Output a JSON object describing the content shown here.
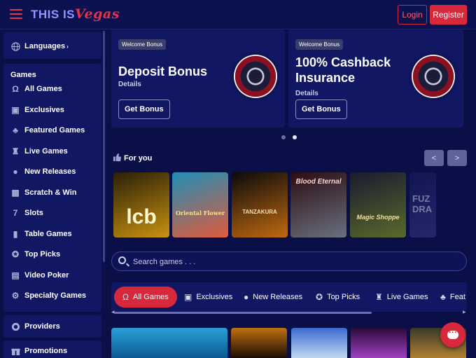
{
  "header": {
    "logo_part1": "THIS IS",
    "logo_part2": "Vegas",
    "login_label": "Login",
    "register_label": "Register"
  },
  "sidebar": {
    "languages_label": "Languages",
    "games_heading": "Games",
    "items": [
      {
        "label": "All Games",
        "icon": "horseshoe-icon"
      },
      {
        "label": "Exclusives",
        "icon": "exclusive-icon"
      },
      {
        "label": "Featured Games",
        "icon": "clover-icon"
      },
      {
        "label": "Live Games",
        "icon": "live-dealer-icon"
      },
      {
        "label": "New Releases",
        "icon": "cherries-icon"
      },
      {
        "label": "Scratch & Win",
        "icon": "scratch-card-icon"
      },
      {
        "label": "Slots",
        "icon": "seven-icon"
      },
      {
        "label": "Table Games",
        "icon": "table-games-icon"
      },
      {
        "label": "Top Picks",
        "icon": "medal-icon"
      },
      {
        "label": "Video Poker",
        "icon": "video-poker-icon"
      },
      {
        "label": "Specialty Games",
        "icon": "gear-icon"
      }
    ],
    "providers_label": "Providers",
    "promotions_label": "Promotions"
  },
  "banners": [
    {
      "tag": "Welcome Bonus",
      "title_line1": "Deposit Bonus",
      "title_line2": "",
      "details": "Details",
      "button": "Get Bonus"
    },
    {
      "tag": "Welcome Bonus",
      "title_line1": "100% Cashback",
      "title_line2": "Insurance",
      "details": "Details",
      "button": "Get Bonus"
    }
  ],
  "carousel": {
    "active_dot": 2,
    "dot_count": 2
  },
  "for_you": {
    "heading": "For you",
    "prev": "<",
    "next": ">",
    "games": [
      {
        "title": "lcb",
        "colors": [
          "#2a1f07",
          "#c99210"
        ]
      },
      {
        "title": "Oriental Flower",
        "colors": [
          "#1f8fb8",
          "#e05a3a"
        ]
      },
      {
        "title": "TANZAKURA",
        "colors": [
          "#0a0a0a",
          "#c06a10"
        ]
      },
      {
        "title": "Blood Eternal",
        "colors": [
          "#2a0c10",
          "#6a7080"
        ]
      },
      {
        "title": "Magic Shoppe",
        "colors": [
          "#1a1a30",
          "#5a6a2a"
        ]
      },
      {
        "title": "FUZ DRA",
        "colors": [
          "#1a1c5a",
          "#3a3a8a"
        ]
      }
    ]
  },
  "search": {
    "placeholder": "Search games . . ."
  },
  "categories": [
    {
      "label": "All Games",
      "icon": "horseshoe-icon",
      "active": true
    },
    {
      "label": "Exclusives",
      "icon": "exclusive-icon",
      "active": false
    },
    {
      "label": "New Releases",
      "icon": "cherries-icon",
      "active": false
    },
    {
      "label": "Top Picks",
      "icon": "medal-icon",
      "active": false
    },
    {
      "label": "Live Games",
      "icon": "live-dealer-icon",
      "active": false
    },
    {
      "label": "Feat",
      "icon": "clover-icon",
      "active": false
    }
  ],
  "colors": {
    "accent": "#d8283b",
    "panel": "#111762",
    "background": "#0b0f48"
  }
}
